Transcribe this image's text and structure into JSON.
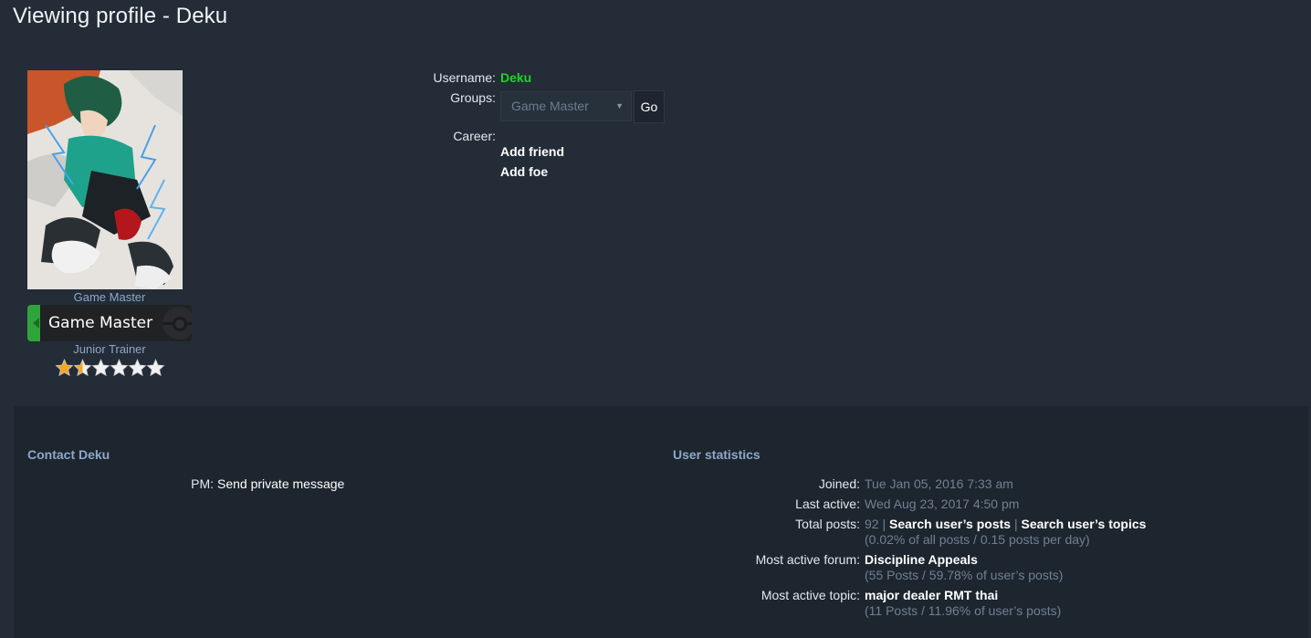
{
  "header": {
    "title": "Viewing profile - Deku"
  },
  "profile": {
    "rank_text": "Game Master",
    "rank_banner": "Game Master",
    "trainer_rank": "Junior Trainer",
    "stars": {
      "filled": 1.5,
      "total": 6
    },
    "username_label": "Username:",
    "username": "Deku",
    "username_color": "#1fd61f",
    "groups_label": "Groups:",
    "groups_selected": "Game Master",
    "go_label": "Go",
    "career_label": "Career:",
    "add_friend": "Add friend",
    "add_foe": "Add foe"
  },
  "contact": {
    "title": "Contact Deku",
    "pm_label": "PM:",
    "pm_link": "Send private message"
  },
  "stats": {
    "title": "User statistics",
    "joined_label": "Joined:",
    "joined_value": "Tue Jan 05, 2016 7:33 am",
    "last_active_label": "Last active:",
    "last_active_value": "Wed Aug 23, 2017 4:50 pm",
    "total_posts_label": "Total posts:",
    "total_posts_value": "92",
    "separator": "|",
    "search_posts": "Search user’s posts",
    "search_topics": "Search user’s topics",
    "posts_detail": "(0.02% of all posts / 0.15 posts per day)",
    "active_forum_label": "Most active forum:",
    "active_forum": "Discipline Appeals",
    "active_forum_detail": "(55 Posts / 59.78% of user’s posts)",
    "active_topic_label": "Most active topic:",
    "active_topic": "major dealer RMT thai",
    "active_topic_detail": "(11 Posts / 11.96% of user’s posts)"
  },
  "colors": {
    "background": "#232c37",
    "panel": "#1d252e",
    "section_heading": "#8fa7c9",
    "muted_text": "#6f8095",
    "rank_flag": "#2fa43a",
    "star_filled": "#f5a623"
  }
}
